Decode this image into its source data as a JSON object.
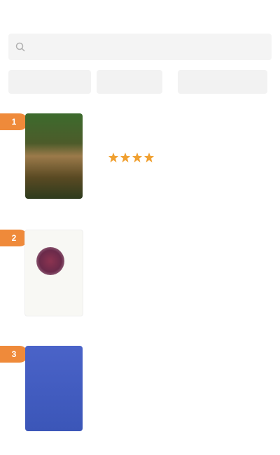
{
  "header": {
    "logo": "",
    "actions": [
      {
        "label": ""
      },
      {
        "label": ""
      }
    ]
  },
  "search": {
    "placeholder": ""
  },
  "filters": [
    {
      "label": ""
    },
    {
      "label": ""
    },
    {
      "label": ""
    }
  ],
  "books": [
    {
      "rank": "1",
      "title": "",
      "subtitle": "",
      "rating": "",
      "price": "",
      "meta": "",
      "cover_color": "#3c6b2d"
    },
    {
      "rank": "2",
      "title": "",
      "subtitle": "",
      "rating": "",
      "price": "",
      "meta": "",
      "cover_color": "#f8f8f4"
    },
    {
      "rank": "3",
      "title": "",
      "subtitle": "",
      "rating": "",
      "price": "",
      "meta": "",
      "cover_color": "#4a63c8"
    }
  ],
  "colors": {
    "badge": "#ef8a3a",
    "star": "#f0a030",
    "price": "#e0507a"
  }
}
